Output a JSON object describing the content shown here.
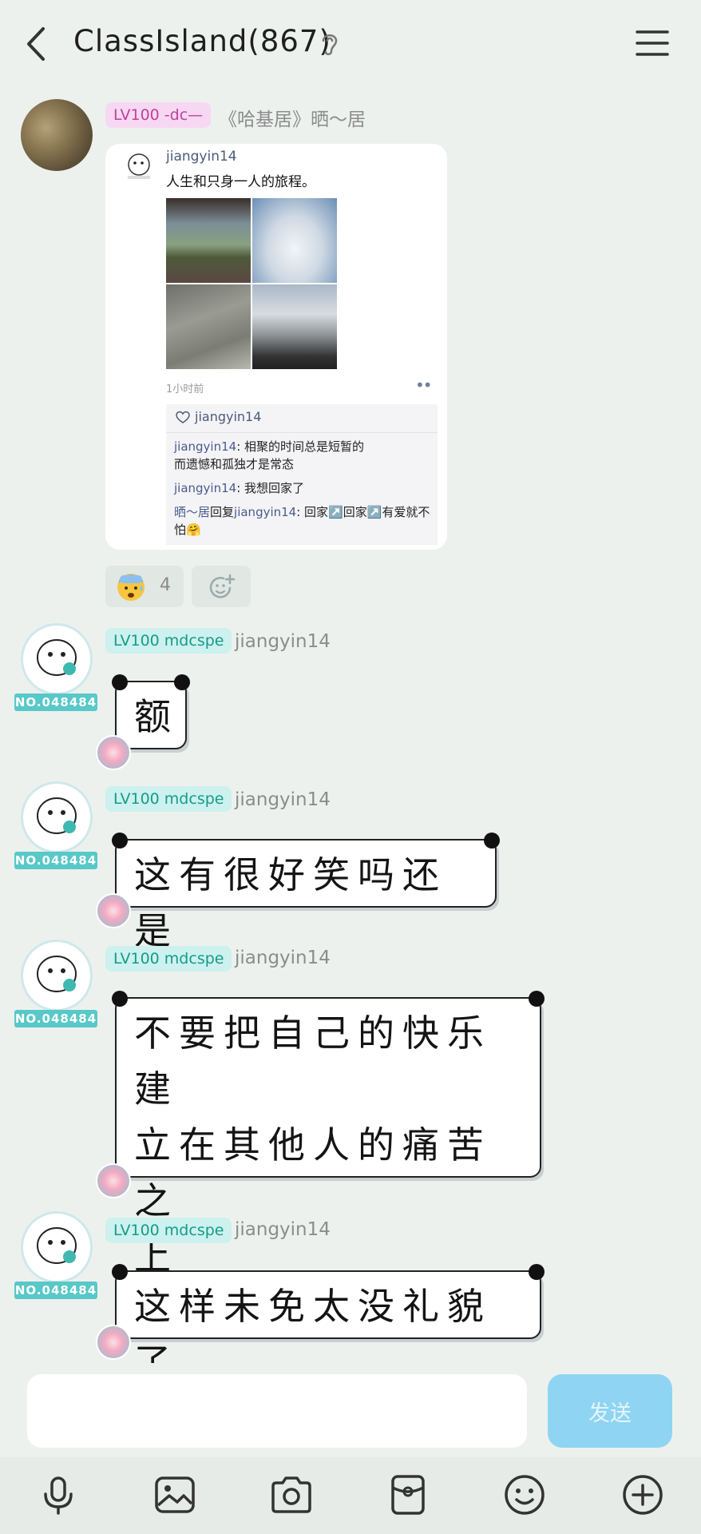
{
  "header": {
    "title": "ClassIsland(867)",
    "back_icon": "chevron-left-icon",
    "ear_icon": "ear-icon",
    "menu_icon": "hamburger-menu-icon"
  },
  "messages": [
    {
      "badge": "LV100 -dc—",
      "username": "《哈基居》晒～居",
      "shared_post": {
        "author": "jiangyin14",
        "text": "人生和只身一人的旅程。",
        "time": "1小时前",
        "more": "••",
        "like_user": "jiangyin14",
        "comments": [
          {
            "user": "jiangyin14",
            "text": ": 相聚的时间总是短暂的"
          },
          {
            "user": "",
            "text": "而遗憾和孤独才是常态"
          },
          {
            "user": "jiangyin14",
            "text": ": 我想回家了"
          },
          {
            "user": "晒～居",
            "reply_word": "回复",
            "reply_to": "jiangyin14",
            "text": ": 回家↗️回家↗️有爱就不"
          },
          {
            "user": "",
            "text": "怕🤗"
          }
        ]
      },
      "reaction_count": "4"
    },
    {
      "badge": "LV100 mdcspe",
      "username": "jiangyin14",
      "sticker_no": "NO.048484",
      "text_line1": "额",
      "text_line2": "",
      "text_line3": ""
    },
    {
      "badge": "LV100 mdcspe",
      "username": "jiangyin14",
      "sticker_no": "NO.048484",
      "text_line1": "这有很好笑吗还是",
      "text_line2": "",
      "text_line3": ""
    },
    {
      "badge": "LV100 mdcspe",
      "username": "jiangyin14",
      "sticker_no": "NO.048484",
      "text_line1": "不要把自己的快乐建",
      "text_line2": "立在其他人的痛苦之",
      "text_line3": "上"
    },
    {
      "badge": "LV100 mdcspe",
      "username": "jiangyin14",
      "sticker_no": "NO.048484",
      "text_line1": "这样未免太没礼貌了",
      "text_line2": "",
      "text_line3": ""
    }
  ],
  "input": {
    "placeholder": "",
    "send_label": "发送"
  },
  "toolbar": [
    "microphone-icon",
    "image-icon",
    "camera-icon",
    "red-packet-icon",
    "emoji-icon",
    "plus-icon"
  ],
  "colors": {
    "background": "#edf1ee",
    "send_button": "#8fd4f2",
    "badge_pink": "#f7d8f2",
    "badge_teal": "#cdf1ee"
  }
}
